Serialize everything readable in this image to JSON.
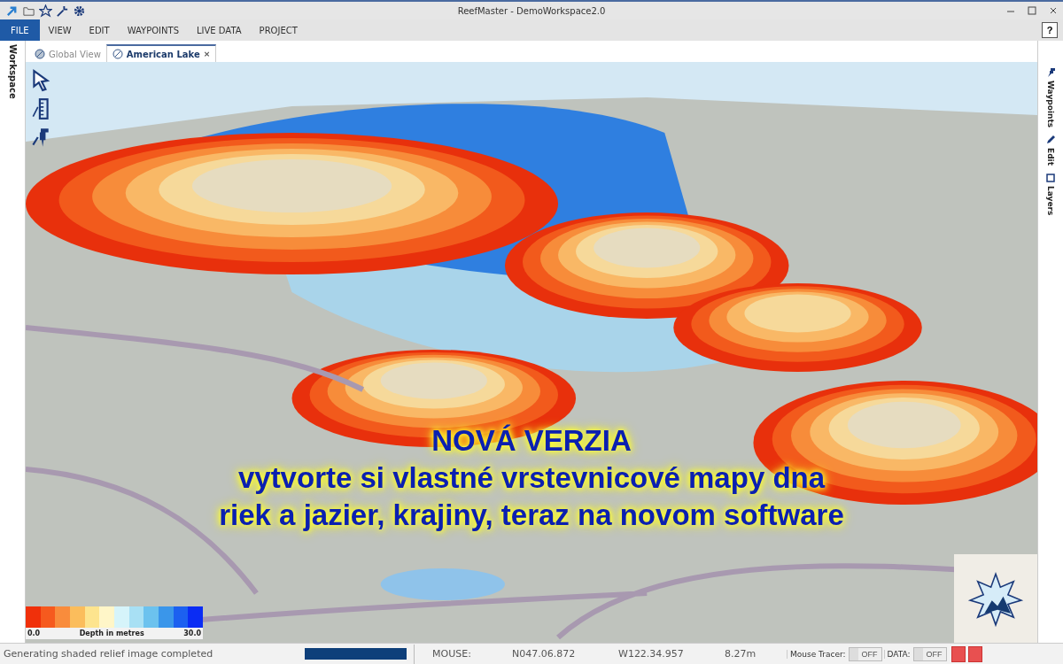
{
  "window": {
    "title": "ReefMaster - DemoWorkspace2.0"
  },
  "menu": [
    {
      "label": "FILE",
      "selected": true
    },
    {
      "label": "VIEW",
      "selected": false
    },
    {
      "label": "EDIT",
      "selected": false
    },
    {
      "label": "WAYPOINTS",
      "selected": false
    },
    {
      "label": "LIVE DATA",
      "selected": false
    },
    {
      "label": "PROJECT",
      "selected": false
    }
  ],
  "help_button": "?",
  "left_panel": {
    "label": "Workspace"
  },
  "tabs": [
    {
      "label": "Global View",
      "selected": false,
      "closable": false
    },
    {
      "label": "American Lake",
      "selected": true,
      "closable": true
    }
  ],
  "tab_close": "×",
  "right_panel": [
    {
      "label": "Waypoints",
      "kind": "pin"
    },
    {
      "label": "Edit",
      "kind": "pencil"
    },
    {
      "label": "Layers",
      "kind": "layers"
    }
  ],
  "legend": {
    "swatches": [
      {
        "color": "#f0300a"
      },
      {
        "color": "#f65a1e"
      },
      {
        "color": "#f98c3c"
      },
      {
        "color": "#fbbd5c"
      },
      {
        "color": "#fde48e"
      },
      {
        "color": "#fff6c8"
      },
      {
        "color": "#d6f4fa"
      },
      {
        "color": "#a8e0f4"
      },
      {
        "color": "#6cc2ee"
      },
      {
        "color": "#3a96ea"
      },
      {
        "color": "#1c60f0"
      },
      {
        "color": "#0a2cf4"
      }
    ],
    "min": "0.0",
    "title": "Depth in metres",
    "max": "30.0"
  },
  "caption": [
    "NOVÁ VERZIA",
    "vytvorte si vlastné vrstevnicové mapy dna",
    "riek a jazier, krajiny, teraz na novom software"
  ],
  "status_bar": {
    "message": "Generating shaded relief image completed",
    "progress": {
      "level": 1
    },
    "mouse_label": "MOUSE:",
    "latitude": "N047.06.872",
    "longitude": "W122.34.957",
    "depth": "8.27m",
    "toggles": [
      {
        "label": "Mouse Tracer:",
        "state": "OFF",
        "on": false
      },
      {
        "label": "DATA:",
        "state": "OFF",
        "on": false
      }
    ]
  }
}
